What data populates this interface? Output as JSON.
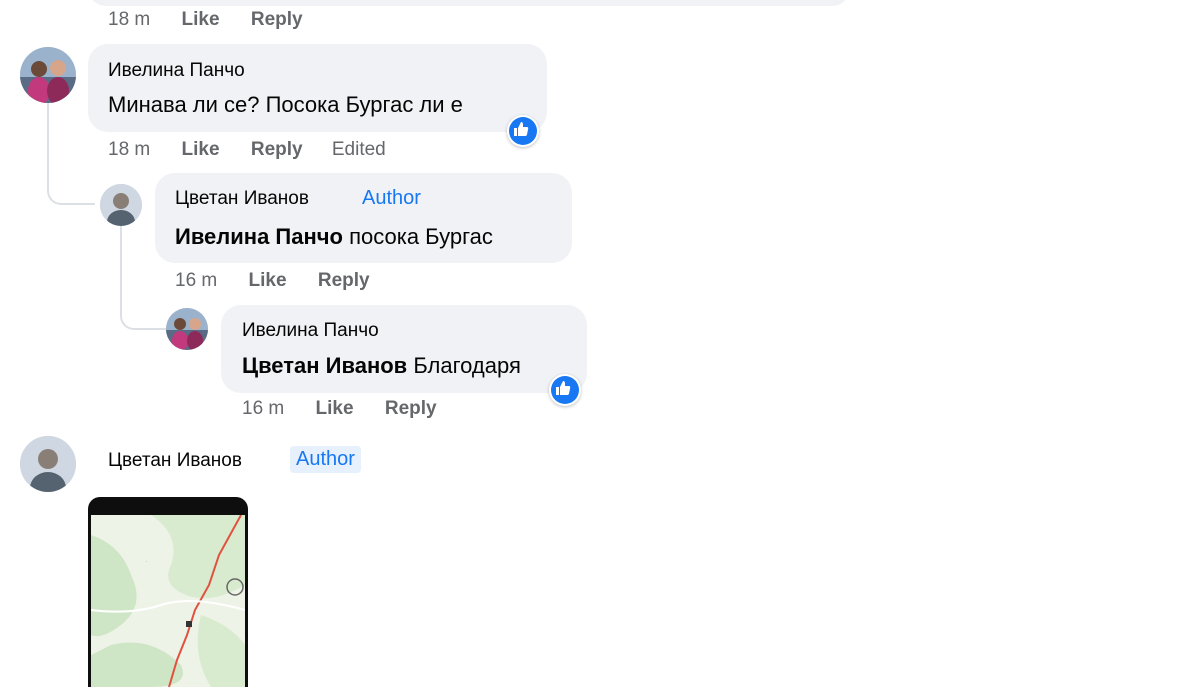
{
  "comments": [
    {
      "meta": {
        "time": "18 m",
        "like": "Like",
        "reply": "Reply"
      }
    },
    {
      "author": "Ивелина Панчо",
      "text": "Минава ли се? Посока Бургас ли е",
      "meta": {
        "time": "18 m",
        "like": "Like",
        "reply": "Reply",
        "edited": "Edited"
      },
      "reaction": "like-icon",
      "replies": [
        {
          "author": "Цветан Иванов",
          "badge": "Author",
          "mention": "Ивелина Панчо",
          "text": "посока Бургас",
          "meta": {
            "time": "16 m",
            "like": "Like",
            "reply": "Reply"
          }
        },
        {
          "author": "Ивелина Панчо",
          "mention": "Цветан Иванов",
          "text": "Благодаря",
          "meta": {
            "time": "16 m",
            "like": "Like",
            "reply": "Reply"
          },
          "reaction": "like-icon"
        }
      ]
    },
    {
      "author": "Цветан Иванов",
      "badge": "Author",
      "attachment": "map-screenshot"
    }
  ],
  "colors": {
    "bubble": "#f0f2f5",
    "author_badge": "#1877f2",
    "meta_text": "#65676b",
    "like_blue": "#1877f2"
  }
}
